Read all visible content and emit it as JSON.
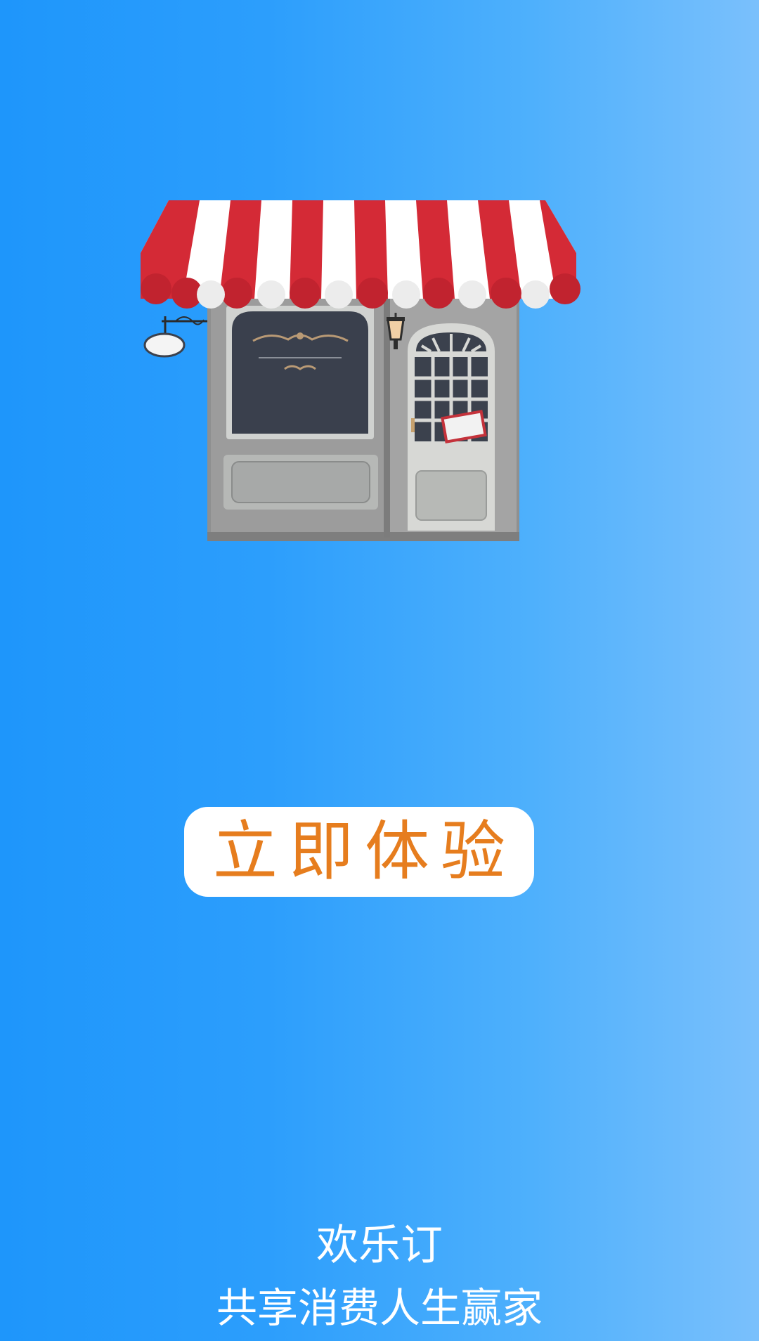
{
  "splash": {
    "illustration": "storefront-illustration",
    "cta_label": "立即体验",
    "app_name": "欢乐订",
    "slogan": "共享消费人生赢家"
  },
  "colors": {
    "background_left": "#1e96fb",
    "background_right": "#7ac0fc",
    "cta_background": "#ffffff",
    "cta_text": "#e67d1e",
    "footer_text": "#ffffff",
    "awning_red": "#d42a36"
  }
}
